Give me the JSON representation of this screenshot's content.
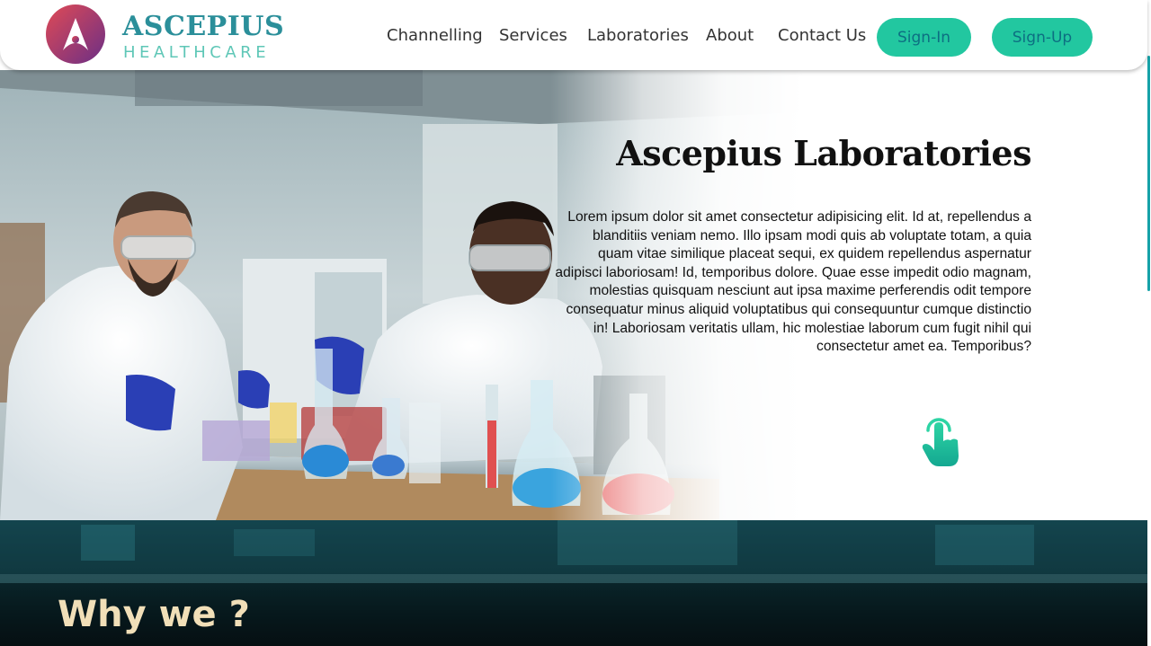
{
  "brand": {
    "name": "ASCEPIUS",
    "subtitle": "HEALTHCARE",
    "colors": {
      "primary": "#2b8f9a",
      "accent": "#22c7a0",
      "gradient_start": "#d23a5a",
      "gradient_end": "#6a2a8a"
    }
  },
  "nav": {
    "items": [
      {
        "label": "Channelling"
      },
      {
        "label": "Services"
      },
      {
        "label": "Laboratories"
      },
      {
        "label": "About"
      },
      {
        "label": "Contact Us"
      }
    ],
    "signin_label": "Sign-In",
    "signup_label": "Sign-Up"
  },
  "hero": {
    "title": "Ascepius Laboratories",
    "body": "Lorem ipsum dolor sit amet consectetur adipisicing elit. Id at, repellendus a blanditiis veniam nemo. Illo ipsam modi quis ab voluptate totam, a quia quam vitae similique placeat sequi, ex quidem repellendus aspernatur adipisci laboriosam! Id, temporibus dolore. Quae esse impedit odio magnam, molestias quisquam nesciunt aut ipsa maxime perferendis odit tempore consequatur minus aliquid voluptatibus qui consequuntur cumque distinctio in! Laboriosam veritatis ullam, hic molestiae laborum cum fugit nihil qui consectetur amet ea. Temporibus?",
    "cta_icon": "tap-hand-icon"
  },
  "why": {
    "title": "Why we ?"
  }
}
